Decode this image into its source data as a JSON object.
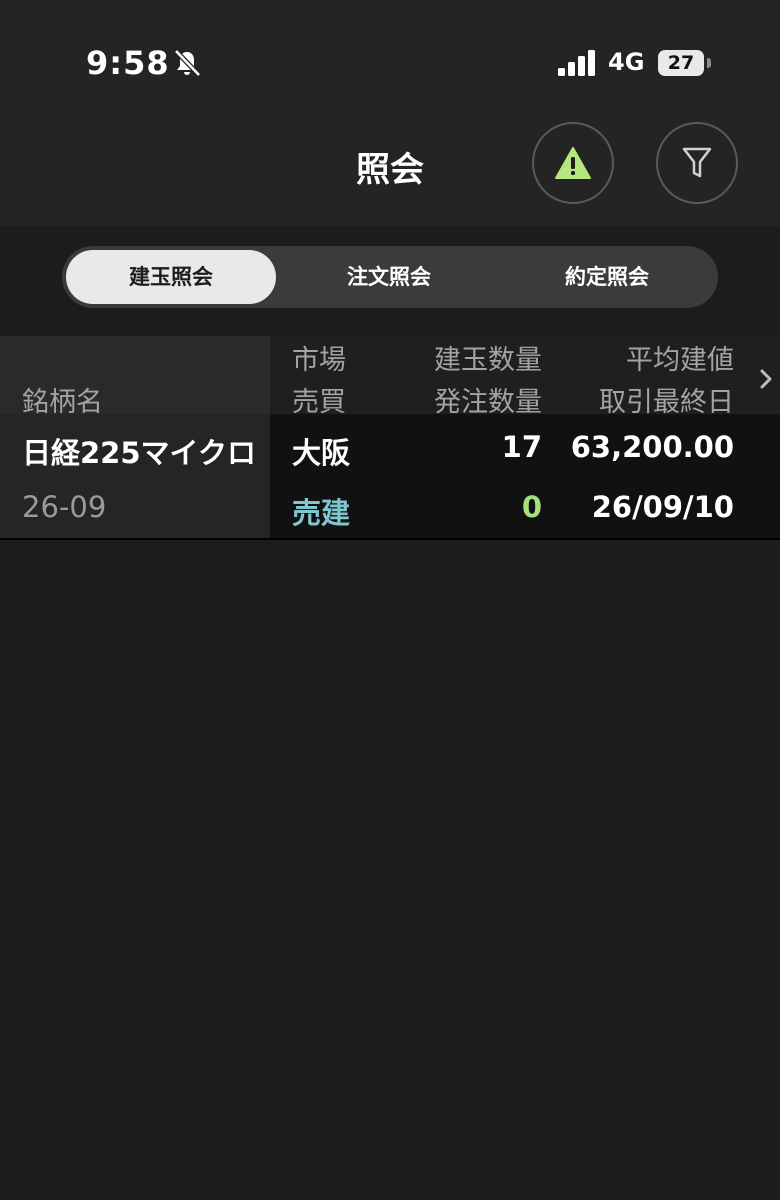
{
  "status_bar": {
    "time": "9:58",
    "network": "4G",
    "battery": "27",
    "icons": [
      "bell-slash-icon",
      "signal-icon",
      "battery-icon"
    ]
  },
  "header": {
    "title": "照会",
    "icons": [
      "warning-icon",
      "filter-icon"
    ]
  },
  "tabs": [
    {
      "label": "建玉照会",
      "active": true
    },
    {
      "label": "注文照会",
      "active": false
    },
    {
      "label": "約定照会",
      "active": false
    }
  ],
  "table": {
    "headers": {
      "name": "銘柄名",
      "market": "市場",
      "side": "売買",
      "position_qty": "建玉数量",
      "order_qty": "発注数量",
      "avg_price": "平均建値",
      "last_trade_date": "取引最終日"
    },
    "rows": [
      {
        "name": "日経225マイクロ",
        "contract_month": "26-09",
        "market": "大阪",
        "side": "売建",
        "position_qty": "17",
        "order_qty": "0",
        "avg_price": "63,200.00",
        "last_trade_date": "26/09/10"
      }
    ]
  },
  "colors": {
    "background": "#1c1c1c",
    "header_bg": "#242424",
    "side_sell": "#7fc6cf",
    "order_qty": "#a7df7a",
    "warning_icon": "#b6e77f"
  }
}
